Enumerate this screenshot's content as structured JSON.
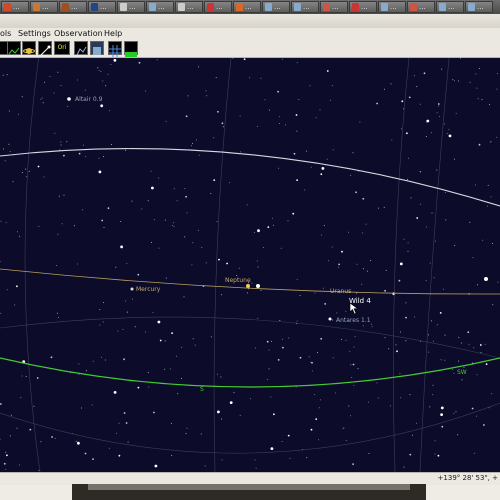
{
  "taskbar": {
    "items": [
      {
        "label": "...",
        "color": "#d04a2a"
      },
      {
        "label": "...",
        "color": "#cc7733"
      },
      {
        "label": "...",
        "color": "#a05020"
      },
      {
        "label": "...",
        "color": "#224488"
      },
      {
        "label": "...",
        "color": "#cccccc"
      },
      {
        "label": "...",
        "color": "#88aacc"
      },
      {
        "label": "...",
        "color": "#cccccc"
      },
      {
        "label": "...",
        "color": "#cc3333"
      },
      {
        "label": "...",
        "color": "#dd6622"
      },
      {
        "label": "...",
        "color": "#88aacc"
      },
      {
        "label": "...",
        "color": "#88aacc"
      },
      {
        "label": "...",
        "color": "#cc5544"
      },
      {
        "label": "...",
        "color": "#cc3333"
      },
      {
        "label": "...",
        "color": "#88aacc"
      },
      {
        "label": "...",
        "color": "#cc5544"
      },
      {
        "label": "...",
        "color": "#88aacc"
      },
      {
        "label": "...",
        "color": "#88aacc"
      }
    ]
  },
  "menu": {
    "tools": "ols",
    "settings": "Settings",
    "observation": "Observation",
    "help": "Help"
  },
  "toolbar": {
    "icons": [
      "planet-toolbar-icon",
      "solar-system-toolbar-icon",
      "comet-toolbar-icon",
      "orion-toolbar-icon",
      "constellation-lines-toolbar-icon",
      "dss-toolbar-icon",
      "grid-toolbar-icon",
      "ground-toolbar-icon"
    ],
    "orion_label": "Ori"
  },
  "sky": {
    "colors": {
      "background": "#0c0c2a",
      "equator": "#d8d8e4",
      "ecliptic": "#b8a060",
      "horizon": "#44cc33",
      "grid": "#3c3c5c"
    },
    "labels": {
      "altair": "Altair 0.9",
      "neptune": "Neptune",
      "mercury": "Mercury",
      "uranus": "Uranus",
      "wild4": "Wild 4",
      "antares": "Antares 1.1",
      "sw": "SW",
      "s": "S"
    }
  },
  "status": {
    "coords": "+139° 28' 53\", +"
  }
}
